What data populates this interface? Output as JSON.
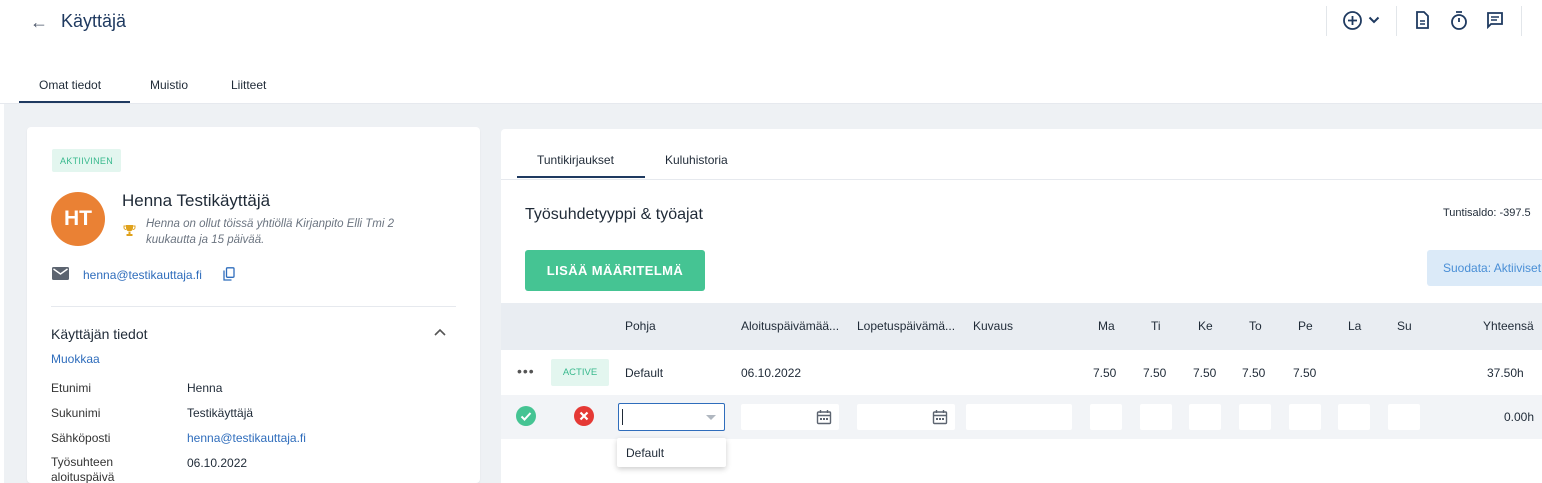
{
  "header": {
    "back_icon": "arrow-left-icon",
    "title": "Käyttäjä",
    "actions": [
      {
        "name": "add-circle-icon"
      },
      {
        "name": "chevron-down-icon"
      },
      {
        "name": "document-icon"
      },
      {
        "name": "stopwatch-icon"
      },
      {
        "name": "comment-icon"
      }
    ]
  },
  "main_tabs": [
    {
      "label": "Omat tiedot",
      "active": true
    },
    {
      "label": "Muistio",
      "active": false
    },
    {
      "label": "Liitteet",
      "active": false
    }
  ],
  "profile": {
    "status": "AKTIIVINEN",
    "initials": "HT",
    "name": "Henna Testikäyttäjä",
    "tenure": "Henna on ollut töissä yhtiöllä Kirjanpito Elli Tmi 2 kuukautta ja 15 päivää.",
    "email": "henna@testikauttaja.fi",
    "section_title": "Käyttäjän tiedot",
    "edit_label": "Muokkaa",
    "fields": [
      {
        "label": "Etunimi",
        "value": "Henna"
      },
      {
        "label": "Sukunimi",
        "value": "Testikäyttäjä"
      },
      {
        "label": "Sähköposti",
        "value": "henna@testikauttaja.fi"
      },
      {
        "label": "Työsuhteen aloituspäivä",
        "value": "06.10.2022"
      }
    ]
  },
  "right": {
    "tabs": [
      {
        "label": "Tuntikirjaukset",
        "active": true
      },
      {
        "label": "Kuluhistoria",
        "active": false
      }
    ],
    "heading": "Työsuhdetyyppi & työajat",
    "balance": "Tuntisaldo: -397.5",
    "add_button": "LISÄÄ MÄÄRITELMÄ",
    "filter_button": "Suodata: Aktiiviset",
    "columns": [
      "Pohja",
      "Aloituspäivämää...",
      "Lopetuspäivämä...",
      "Kuvaus",
      "Ma",
      "Ti",
      "Ke",
      "To",
      "Pe",
      "La",
      "Su",
      "Yhteensä"
    ],
    "rows": [
      {
        "status": "ACTIVE",
        "pohja": "Default",
        "start": "06.10.2022",
        "end": "",
        "desc": "",
        "ma": "7.50",
        "ti": "7.50",
        "ke": "7.50",
        "to": "7.50",
        "pe": "7.50",
        "la": "",
        "su": "",
        "total": "37.50h"
      }
    ],
    "edit_row": {
      "total": "0.00h"
    },
    "dropdown_options": [
      "Default"
    ]
  },
  "colors": {
    "primary_green": "#45c493",
    "navy": "#1f3a60",
    "link_blue": "#2f6dbc",
    "avatar_orange": "#ea8134",
    "danger_red": "#e53935"
  }
}
